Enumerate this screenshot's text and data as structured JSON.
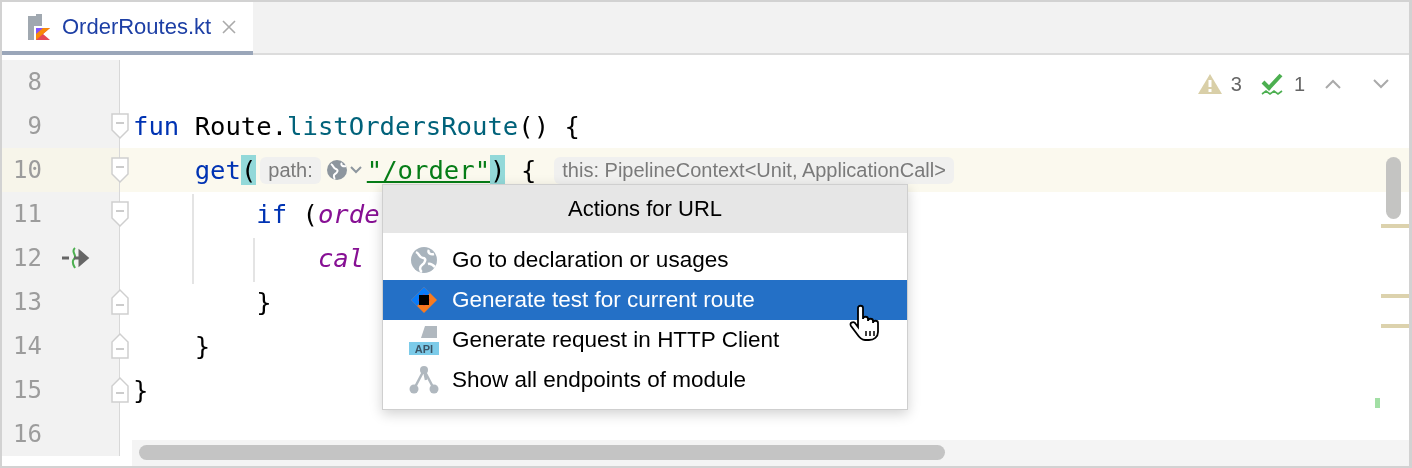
{
  "tabs": [
    {
      "label": "OrderRoutes.kt",
      "selected": true
    }
  ],
  "inspections": {
    "warnings": "3",
    "weak_warnings": "1"
  },
  "editor": {
    "lines": [
      {
        "number": "8",
        "current": false,
        "fold_start": false,
        "fold_end": false,
        "route_icon": false
      },
      {
        "number": "9",
        "current": false,
        "fold_start": true,
        "fold_end": false,
        "route_icon": false,
        "segments": [
          {
            "kind": "code",
            "tokens": [
              {
                "kind": "keyword",
                "text": "fun"
              },
              {
                "kind": "plain",
                "text": " Route."
              },
              {
                "kind": "function",
                "text": "listOrdersRoute"
              },
              {
                "kind": "plain",
                "text": "() {"
              }
            ]
          }
        ]
      },
      {
        "number": "10",
        "current": true,
        "fold_start": true,
        "fold_end": false,
        "route_icon": false,
        "segments": [
          {
            "kind": "code",
            "tokens": [
              {
                "kind": "keyword",
                "text": "    get"
              },
              {
                "kind": "brace_match",
                "text": "("
              }
            ]
          },
          {
            "kind": "hint",
            "text": "path:"
          },
          {
            "kind": "globe"
          },
          {
            "kind": "code",
            "tokens": [
              {
                "kind": "string",
                "text": "\"/order\""
              },
              {
                "kind": "brace_match",
                "text": ")"
              },
              {
                "kind": "plain",
                "text": " {"
              }
            ]
          },
          {
            "kind": "hint",
            "text": "this: PipelineContext<Unit, ApplicationCall>"
          }
        ]
      },
      {
        "number": "11",
        "current": false,
        "fold_start": true,
        "fold_end": false,
        "route_icon": false,
        "segments": [
          {
            "kind": "code",
            "tokens": [
              {
                "kind": "keyword",
                "text": "        if"
              },
              {
                "kind": "plain",
                "text": " ("
              },
              {
                "kind": "variable",
                "text": "orde"
              }
            ]
          }
        ]
      },
      {
        "number": "12",
        "current": false,
        "fold_start": false,
        "fold_end": false,
        "route_icon": true,
        "segments": [
          {
            "kind": "code",
            "tokens": [
              {
                "kind": "variable",
                "text": "            cal"
              }
            ]
          }
        ]
      },
      {
        "number": "13",
        "current": false,
        "fold_start": false,
        "fold_end": true,
        "route_icon": false,
        "segments": [
          {
            "kind": "code",
            "tokens": [
              {
                "kind": "plain",
                "text": "        }"
              }
            ]
          }
        ]
      },
      {
        "number": "14",
        "current": false,
        "fold_start": false,
        "fold_end": true,
        "route_icon": false,
        "segments": [
          {
            "kind": "code",
            "tokens": [
              {
                "kind": "plain",
                "text": "    }"
              }
            ]
          }
        ]
      },
      {
        "number": "15",
        "current": false,
        "fold_start": false,
        "fold_end": true,
        "route_icon": false,
        "segments": [
          {
            "kind": "code",
            "tokens": [
              {
                "kind": "plain",
                "text": "}"
              }
            ]
          }
        ]
      },
      {
        "number": "16",
        "current": false,
        "fold_start": false,
        "fold_end": false,
        "route_icon": false
      }
    ]
  },
  "popup": {
    "title": "Actions for URL",
    "items": [
      {
        "label": "Go to declaration or usages",
        "kind": "globe",
        "selected": false
      },
      {
        "label": "Generate test for current route",
        "kind": "test",
        "selected": true
      },
      {
        "label": "Generate request in HTTP Client",
        "kind": "api",
        "icon_text": "API",
        "selected": false
      },
      {
        "label": "Show all endpoints of module",
        "kind": "endpoints",
        "selected": false
      }
    ]
  }
}
